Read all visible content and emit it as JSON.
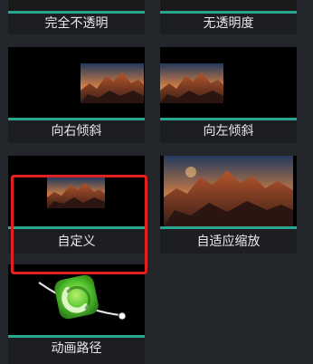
{
  "tiles": [
    {
      "label": "完全不透明"
    },
    {
      "label": "无透明度"
    },
    {
      "label": "向右倾斜"
    },
    {
      "label": "向左倾斜"
    },
    {
      "label": "自定义"
    },
    {
      "label": "自适应缩放"
    },
    {
      "label": "动画路径"
    }
  ],
  "colors": {
    "accent": "#2aa58f",
    "selection": "#e02020",
    "background": "#23262b"
  }
}
